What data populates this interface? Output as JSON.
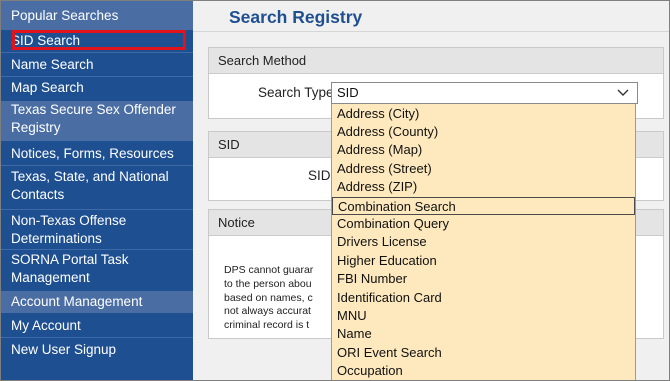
{
  "sidebar": {
    "items": [
      {
        "label": "Popular Searches"
      },
      {
        "label": "SID Search"
      },
      {
        "label": "Name Search"
      },
      {
        "label": "Map Search"
      },
      {
        "label": "Texas Secure Sex Offender",
        "label2": "Registry"
      },
      {
        "label": "Notices, Forms, Resources"
      },
      {
        "label": "Texas, State, and National",
        "label2": "Contacts"
      },
      {
        "label": "Non-Texas Offense",
        "label2": "Determinations"
      },
      {
        "label": "SORNA Portal Task",
        "label2": "Management"
      },
      {
        "label": "Account Management"
      },
      {
        "label": "My Account"
      },
      {
        "label": "New User Signup"
      }
    ]
  },
  "main": {
    "title": "Search Registry",
    "search_method": {
      "header": "Search Method",
      "label": "Search Type",
      "selected": "SID"
    },
    "sid_panel": {
      "header": "SID",
      "label": "SID"
    },
    "notice": {
      "header": "Notice",
      "lines": [
        "DPS cannot guarar",
        "to the person abou",
        "based on names, c",
        "not always accurat",
        "criminal record is t"
      ]
    }
  },
  "dropdown": {
    "options": [
      "Address (City)",
      "Address (County)",
      "Address (Map)",
      "Address (Street)",
      "Address (ZIP)",
      "Combination Search",
      "Combination Query",
      "Drivers License",
      "Higher Education",
      "FBI Number",
      "Identification Card",
      "MNU",
      "Name",
      "ORI Event Search",
      "Occupation"
    ],
    "highlighted": "Combination Search"
  },
  "colors": {
    "sidebar_bg": "#1e4f91",
    "sidebar_alt": "#4a6ea3",
    "title": "#1f4f91",
    "dropdown_bg": "#fde9bd",
    "highlight_border": "#e1141b"
  }
}
